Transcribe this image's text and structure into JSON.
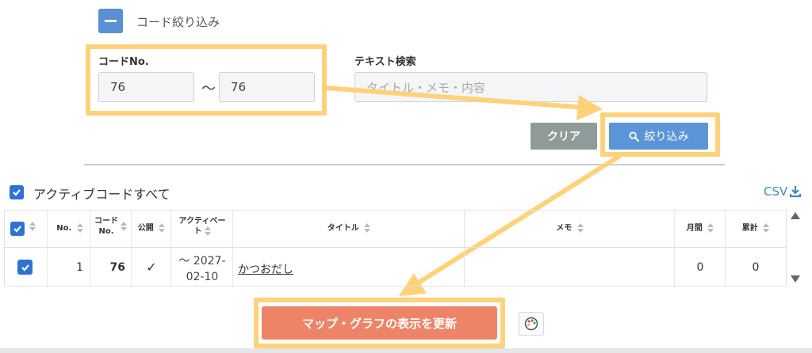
{
  "filter": {
    "title": "コード絞り込み",
    "code_label": "コードNo.",
    "code_from": "76",
    "code_to": "76",
    "tilde": "～",
    "text_label": "テキスト検索",
    "text_placeholder": "タイトル・メモ・内容",
    "clear_label": "クリア",
    "filter_label": "絞り込み"
  },
  "active_codes_label": "アクティブコードすべて",
  "csv_label": "CSV",
  "table": {
    "headers": {
      "no": "No.",
      "code_no_1": "コード",
      "code_no_2": "No.",
      "public": "公開",
      "active_1": "アクティベー",
      "active_2": "ト",
      "title": "タイトル",
      "memo": "メモ",
      "monthly": "月間",
      "total": "累計"
    },
    "rows": [
      {
        "no": "1",
        "code": "76",
        "public": "✓",
        "active_1": "～ 2027-",
        "active_2": "02-10",
        "title": "かつおだし",
        "memo": "",
        "monthly": "0",
        "total": "0"
      }
    ]
  },
  "update_label": "マップ・グラフの表示を更新",
  "colors": {
    "accent": "#5b95d8",
    "update": "#ee8467",
    "highlight": "#ffd27a"
  }
}
